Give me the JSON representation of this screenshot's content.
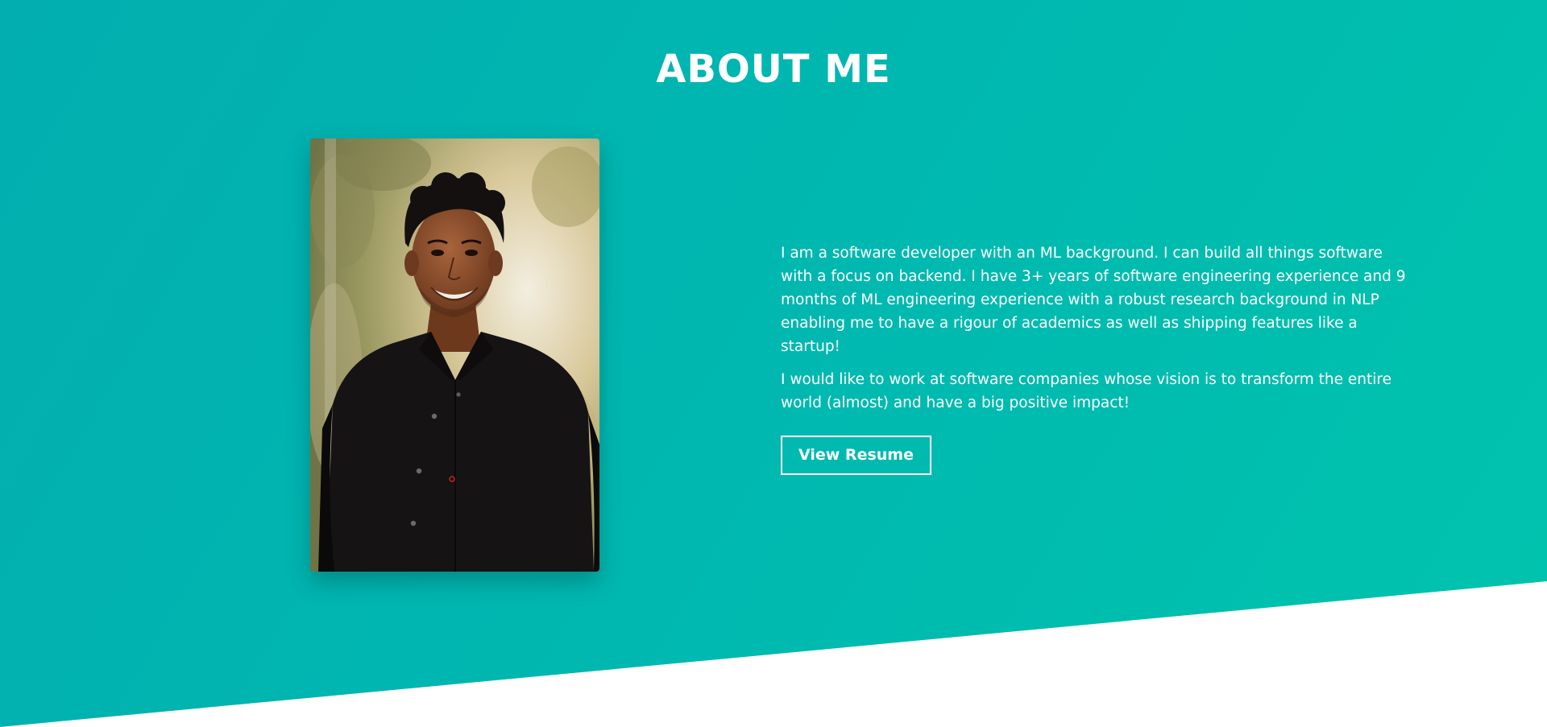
{
  "about": {
    "title": "ABOUT ME",
    "paragraphs": [
      "I am a software developer with an ML background. I can build all things software with a focus on backend. I have 3+ years of software engineering experience and 9 months of ML engineering experience with a robust research background in NLP enabling me to have a rigour of academics as well as shipping features like a startup!",
      "I would like to work at software companies whose vision is to transform the entire world (almost) and have a big positive impact!"
    ],
    "resume_button": "View Resume"
  },
  "colors": {
    "gradient_start": "#02aeb0",
    "gradient_end": "#00c4ad",
    "text": "#ffffff"
  }
}
